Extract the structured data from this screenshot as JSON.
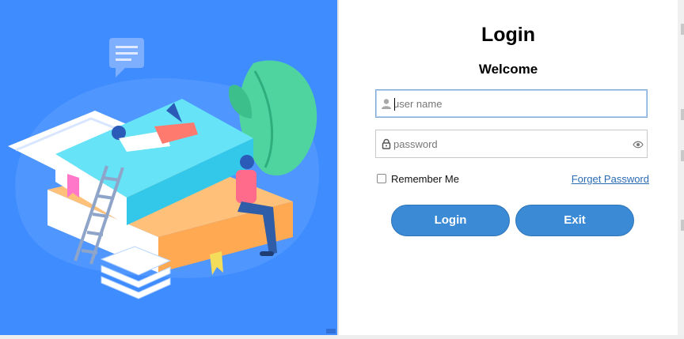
{
  "illustration": {
    "accent": "#3f8cff"
  },
  "login": {
    "title": "Login",
    "subtitle": "Welcome",
    "username": {
      "placeholder": "user name",
      "value": "",
      "icon": "user-icon"
    },
    "password": {
      "placeholder": "password",
      "value": "",
      "icon": "lock-icon",
      "toggle_icon": "eye-icon"
    },
    "remember_label": "Remember Me",
    "remember_checked": false,
    "forgot_label": "Forget Password",
    "login_button": "Login",
    "exit_button": "Exit",
    "button_color": "#3a8ad6"
  }
}
